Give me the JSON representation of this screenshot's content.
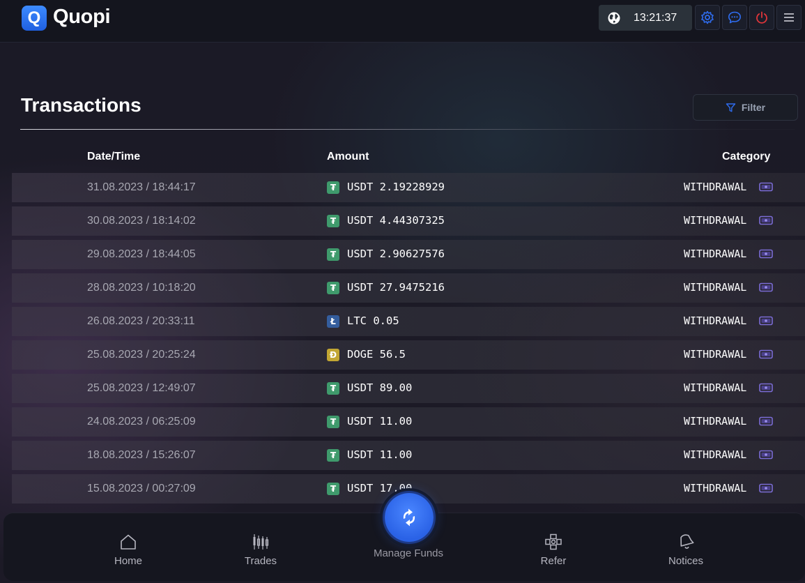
{
  "app": {
    "brand": "Quopi",
    "logo_letter": "Q",
    "clock": "13:21:37",
    "accent": "#2f6df0"
  },
  "page": {
    "title": "Transactions",
    "filter_label": "Filter"
  },
  "table": {
    "columns": [
      "Date/Time",
      "Amount",
      "Category"
    ],
    "rows": [
      {
        "date": "31.08.2023 / 18:44:17",
        "coin": "USDT",
        "amount": "USDT 2.19228929",
        "category": "WITHDRAWAL"
      },
      {
        "date": "30.08.2023 / 18:14:02",
        "coin": "USDT",
        "amount": "USDT 4.44307325",
        "category": "WITHDRAWAL"
      },
      {
        "date": "29.08.2023 / 18:44:05",
        "coin": "USDT",
        "amount": "USDT 2.90627576",
        "category": "WITHDRAWAL"
      },
      {
        "date": "28.08.2023 / 10:18:20",
        "coin": "USDT",
        "amount": "USDT 27.9475216",
        "category": "WITHDRAWAL"
      },
      {
        "date": "26.08.2023 / 20:33:11",
        "coin": "LTC",
        "amount": "LTC 0.05",
        "category": "WITHDRAWAL"
      },
      {
        "date": "25.08.2023 / 20:25:24",
        "coin": "DOGE",
        "amount": "DOGE 56.5",
        "category": "WITHDRAWAL"
      },
      {
        "date": "25.08.2023 / 12:49:07",
        "coin": "USDT",
        "amount": "USDT 89.00",
        "category": "WITHDRAWAL"
      },
      {
        "date": "24.08.2023 / 06:25:09",
        "coin": "USDT",
        "amount": "USDT 11.00",
        "category": "WITHDRAWAL"
      },
      {
        "date": "18.08.2023 / 15:26:07",
        "coin": "USDT",
        "amount": "USDT 11.00",
        "category": "WITHDRAWAL"
      },
      {
        "date": "15.08.2023 / 00:27:09",
        "coin": "USDT",
        "amount": "USDT 17.00",
        "category": "WITHDRAWAL"
      }
    ]
  },
  "coins": {
    "USDT": {
      "glyph": "₮",
      "color": "#3f9a6c",
      "icon": "tether-icon"
    },
    "LTC": {
      "glyph": "Ł",
      "color": "#345d9d",
      "icon": "litecoin-icon"
    },
    "DOGE": {
      "glyph": "Ð",
      "color": "#c2a633",
      "icon": "dogecoin-icon"
    }
  },
  "nav": {
    "home": "Home",
    "trades": "Trades",
    "manage_funds": "Manage Funds",
    "refer": "Refer",
    "notices": "Notices"
  }
}
